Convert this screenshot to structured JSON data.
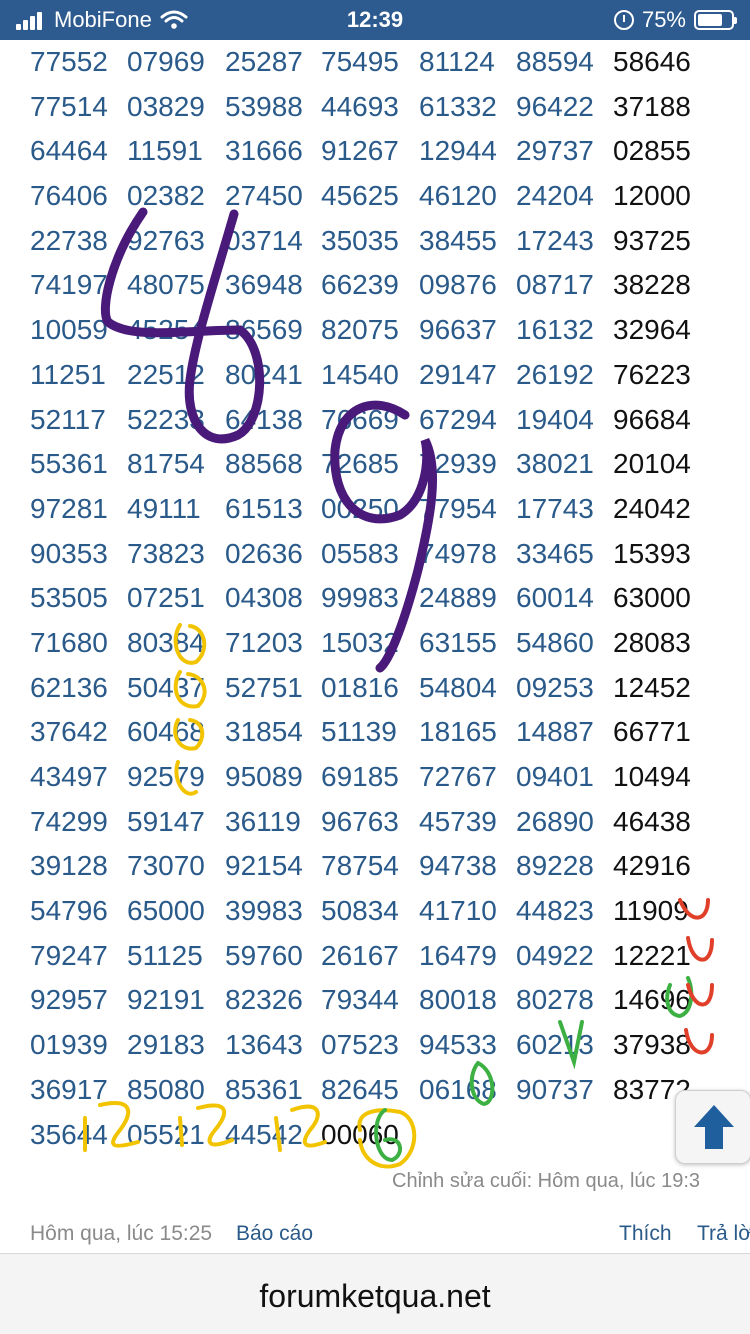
{
  "status_bar": {
    "carrier": "MobiFone",
    "time": "12:39",
    "battery_percent": "75%",
    "battery_level": 0.75
  },
  "results_table": {
    "rows": [
      [
        "77552",
        "07969",
        "25287",
        "75495",
        "81124",
        "88594",
        "58646"
      ],
      [
        "77514",
        "03829",
        "53988",
        "44693",
        "61332",
        "96422",
        "37188"
      ],
      [
        "64464",
        "11591",
        "31666",
        "91267",
        "12944",
        "29737",
        "02855"
      ],
      [
        "76406",
        "02382",
        "27450",
        "45625",
        "46120",
        "24204",
        "12000"
      ],
      [
        "22738",
        "92763",
        "03714",
        "35035",
        "38455",
        "17243",
        "93725"
      ],
      [
        "74197",
        "48075",
        "36948",
        "66239",
        "09876",
        "08717",
        "38228"
      ],
      [
        "10059",
        "45254",
        "86569",
        "82075",
        "96637",
        "16132",
        "32964"
      ],
      [
        "11251",
        "22512",
        "80241",
        "14540",
        "29147",
        "26192",
        "76223"
      ],
      [
        "52117",
        "52233",
        "64138",
        "76669",
        "67294",
        "19404",
        "96684"
      ],
      [
        "55361",
        "81754",
        "88568",
        "72685",
        "72939",
        "38021",
        "20104"
      ],
      [
        "97281",
        "49111",
        "61513",
        "00250",
        "77954",
        "17743",
        "24042"
      ],
      [
        "90353",
        "73823",
        "02636",
        "05583",
        "74978",
        "33465",
        "15393"
      ],
      [
        "53505",
        "07251",
        "04308",
        "99983",
        "24889",
        "60014",
        "63000"
      ],
      [
        "71680",
        "80384",
        "71203",
        "15032",
        "63155",
        "54860",
        "28083"
      ],
      [
        "62136",
        "50437",
        "52751",
        "01816",
        "54804",
        "09253",
        "12452"
      ],
      [
        "37642",
        "60468",
        "31854",
        "51139",
        "18165",
        "14887",
        "66771"
      ],
      [
        "43497",
        "92579",
        "95089",
        "69185",
        "72767",
        "09401",
        "10494"
      ],
      [
        "74299",
        "59147",
        "36119",
        "96763",
        "45739",
        "26890",
        "46438"
      ],
      [
        "39128",
        "73070",
        "92154",
        "78754",
        "94738",
        "89228",
        "42916"
      ],
      [
        "54796",
        "65000",
        "39983",
        "50834",
        "41710",
        "44823",
        "11909"
      ],
      [
        "79247",
        "51125",
        "59760",
        "26167",
        "16479",
        "04922",
        "12221"
      ],
      [
        "92957",
        "92191",
        "82326",
        "79344",
        "80018",
        "80278",
        "14696"
      ],
      [
        "01939",
        "29183",
        "13643",
        "07523",
        "94533",
        "60213",
        "37938"
      ],
      [
        "36917",
        "85080",
        "85361",
        "82645",
        "06168",
        "90737",
        "83772"
      ],
      [
        "35644",
        "05521",
        "44542",
        "00060"
      ]
    ]
  },
  "post": {
    "edit_note": "Chỉnh sửa cuối: Hôm qua, lúc 19:3",
    "posted_time": "Hôm qua, lúc 15:25",
    "report_label": "Báo cáo",
    "like_label": "Thích",
    "reply_label": "Trả lờ"
  },
  "browser": {
    "domain": "forumketqua.net"
  },
  "colors": {
    "status_bar": "#2d5a8f",
    "number_blue": "#2a5a8a",
    "number_black": "#111111",
    "scroll_arrow": "#1f5f9e",
    "purple_scribble": "#4a1a7a",
    "yellow_scribble": "#f2c400",
    "red_scribble": "#e0402a",
    "green_scribble": "#3cb043"
  }
}
